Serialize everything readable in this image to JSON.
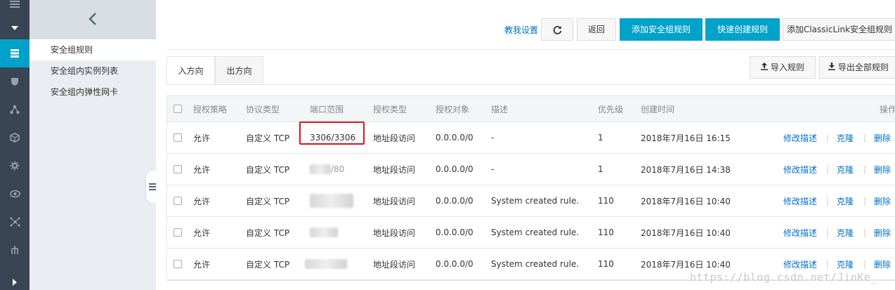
{
  "sidebar": {
    "items": [
      {
        "name": "rail-top-icon",
        "icon": "menu-icon"
      },
      {
        "name": "rail-dropdown",
        "icon": "caret-down-icon"
      },
      {
        "name": "rail-servers",
        "icon": "server-list-icon"
      },
      {
        "name": "rail-shield",
        "icon": "shield-icon"
      },
      {
        "name": "rail-network",
        "icon": "network-icon"
      },
      {
        "name": "rail-cube",
        "icon": "cube-icon"
      },
      {
        "name": "rail-settings",
        "icon": "gear-icon"
      },
      {
        "name": "rail-eye",
        "icon": "eye-icon"
      },
      {
        "name": "rail-topology",
        "icon": "topology-icon"
      },
      {
        "name": "rail-tree",
        "icon": "tree-icon"
      },
      {
        "name": "rail-expand",
        "icon": "chevron-right-icon"
      }
    ]
  },
  "subnav": {
    "back_icon": "chevron-left-icon",
    "items": [
      {
        "label": "安全组规则",
        "active": true
      },
      {
        "label": "安全组内实例列表",
        "active": false
      },
      {
        "label": "安全组内弹性网卡",
        "active": false
      }
    ]
  },
  "toolbar": {
    "help_link": "教我设置",
    "refresh_icon": "refresh-icon",
    "back_label": "返回",
    "add_rule_label": "添加安全组规则",
    "quick_create_label": "快速创建规则",
    "add_classiclink_label": "添加ClassicLink安全组规则"
  },
  "tabs": [
    {
      "label": "入方向",
      "active": true
    },
    {
      "label": "出方向",
      "active": false
    }
  ],
  "actions": {
    "import_label": "导入规则",
    "export_label": "导出全部规则"
  },
  "table": {
    "columns": [
      "授权策略",
      "协议类型",
      "端口范围",
      "授权类型",
      "授权对象",
      "描述",
      "优先级",
      "创建时间",
      "操作"
    ],
    "rows": [
      {
        "policy": "允许",
        "protocol": "自定义 TCP",
        "port": "3306/3306",
        "auth_type": "地址段访问",
        "auth_object": "0.0.0.0/0",
        "description": "-",
        "priority": "1",
        "created": "2018年7月16日 16:15"
      },
      {
        "policy": "允许",
        "protocol": "自定义 TCP",
        "port": "/80",
        "auth_type": "地址段访问",
        "auth_object": "0.0.0.0/0",
        "description": "-",
        "priority": "1",
        "created": "2018年7月16日 14:38"
      },
      {
        "policy": "允许",
        "protocol": "自定义 TCP",
        "port": "",
        "auth_type": "地址段访问",
        "auth_object": "0.0.0.0/0",
        "description": "System created rule.",
        "priority": "110",
        "created": "2018年7月16日 10:40"
      },
      {
        "policy": "允许",
        "protocol": "自定义 TCP",
        "port": "",
        "auth_type": "地址段访问",
        "auth_object": "0.0.0.0/0",
        "description": "System created rule.",
        "priority": "110",
        "created": "2018年7月16日 10:40"
      },
      {
        "policy": "允许",
        "protocol": "自定义 TCP",
        "port": "",
        "auth_type": "地址段访问",
        "auth_object": "0.0.0.0/0",
        "description": "System created rule.",
        "priority": "110",
        "created": "2018年7月16日 10:40"
      }
    ],
    "ops": {
      "edit": "修改描述",
      "clone": "克隆",
      "delete": "删除"
    }
  },
  "watermark": "https://blog.csdn.net/JinKe_",
  "colors": {
    "accent": "#00a2ca",
    "rail": "#394555",
    "link": "#0070cc",
    "highlight": "#d9141a"
  }
}
